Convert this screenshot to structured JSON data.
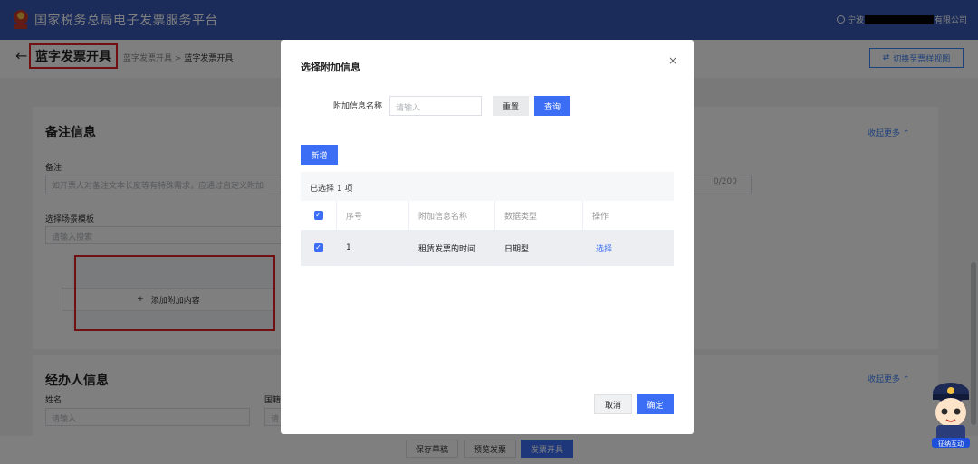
{
  "header": {
    "brand": "国家税务总局电子发票服务平台",
    "user_prefix": "宁波",
    "user_suffix": "有限公司"
  },
  "breadcrumb": {
    "title": "蓝字发票开具",
    "crumb_parent": "蓝字发票开具",
    "separator": ">",
    "crumb_current": "蓝字发票开具",
    "switch_label": "切换至票样视图"
  },
  "remarks_section": {
    "title": "备注信息",
    "collapse_label": "收起更多",
    "remark_label": "备注",
    "remark_placeholder": "如开票人对备注文本长度等有特殊需求，应通过自定义附加",
    "counter": "0/200",
    "template_label": "选择场景模板",
    "template_placeholder": "请输入搜索",
    "add_extra_label": "添加附加内容"
  },
  "agent_section": {
    "title": "经办人信息",
    "collapse_label": "收起更多",
    "name_label": "姓名",
    "name_placeholder": "请输入",
    "nationality_label": "国籍",
    "nationality_placeholder": "请"
  },
  "footer": {
    "save_draft": "保存草稿",
    "preview": "预览发票",
    "issue": "发票开具"
  },
  "modal": {
    "title": "选择附加信息",
    "close": "×",
    "search_label": "附加信息名称",
    "search_placeholder": "请输入",
    "reset": "重置",
    "query": "查询",
    "add_new": "新增",
    "selected_text": "已选择 1 项",
    "columns": [
      "序号",
      "附加信息名称",
      "数据类型",
      "操作"
    ],
    "rows": [
      {
        "index": "1",
        "name": "租赁发票的时间",
        "type": "日期型",
        "action": "选择",
        "checked": true
      }
    ],
    "cancel": "取消",
    "confirm": "确定"
  },
  "mascot": {
    "caption": "征纳互动"
  },
  "colors": {
    "brand_blue": "#3659b5",
    "primary": "#3b6ef5",
    "highlight_red": "#e02020"
  }
}
